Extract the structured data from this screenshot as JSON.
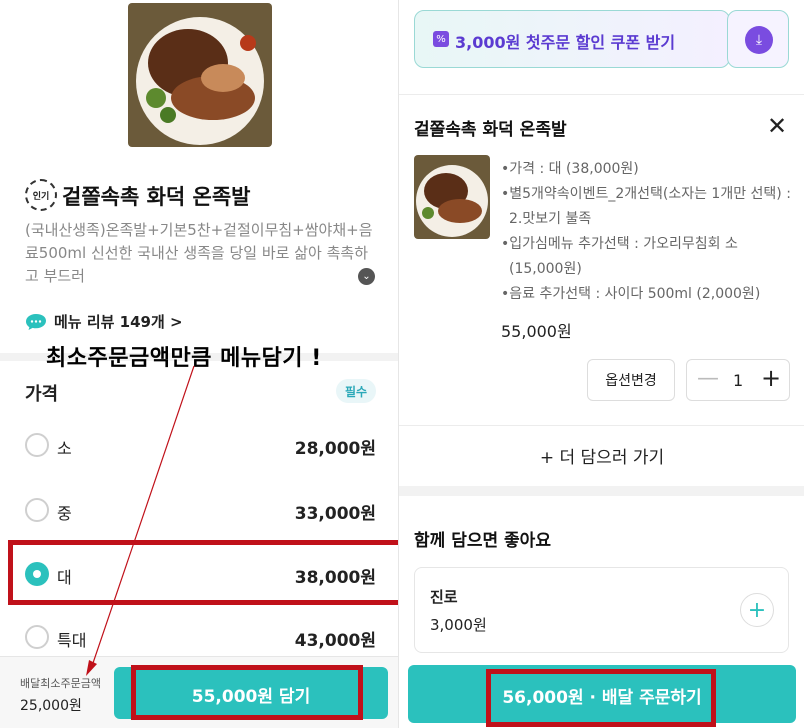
{
  "left": {
    "badge": "인기",
    "menu_name": "겉쫄속촉 화덕 온족발",
    "description": "(국내산생족)온족발+기본5찬+겉절이무침+쌈야채+음료500ml 신선한 국내산 생족을 당일 바로 삶아 촉촉하고 부드러",
    "review_label": "메뉴 리뷰 149개 >",
    "annotation": "최소주문금액만큼 메뉴담기 !",
    "option_group": {
      "title": "가격",
      "required_badge": "필수"
    },
    "options": [
      {
        "label": "소",
        "price": "28,000원",
        "selected": false
      },
      {
        "label": "중",
        "price": "33,000원",
        "selected": false
      },
      {
        "label": "대",
        "price": "38,000원",
        "selected": true
      },
      {
        "label": "특대",
        "price": "43,000원",
        "selected": false
      }
    ],
    "min_order_label": "배달최소주문금액",
    "min_order_value": "25,000원",
    "add_button": "55,000원 담기"
  },
  "right": {
    "coupon_text": "3,000원 첫주문 할인 쿠폰 받기",
    "cart_item_name": "겉쫄속촉 화덕 온족발",
    "option_lines": [
      "•가격 : 대 (38,000원)",
      "•별5개약속이벤트_2개선택(소자는 1개만 선택) : 2.맛보기 불족",
      "•입가심메뉴 추가선택 : 가오리무침회 소 (15,000원)",
      "•음료 추가선택 : 사이다 500ml (2,000원)"
    ],
    "line_price": "55,000원",
    "change_option_button": "옵션변경",
    "quantity": "1",
    "add_more": "+ 더 담으러 가기",
    "recommend_title": "함께 담으면 좋아요",
    "recommend_item": {
      "name": "진로",
      "price": "3,000원"
    },
    "order_button": "56,000원 · 배달 주문하기"
  },
  "colors": {
    "accent": "#2bc1bd",
    "highlight_box": "#c0111a",
    "coupon_purple": "#7a4ce0"
  }
}
